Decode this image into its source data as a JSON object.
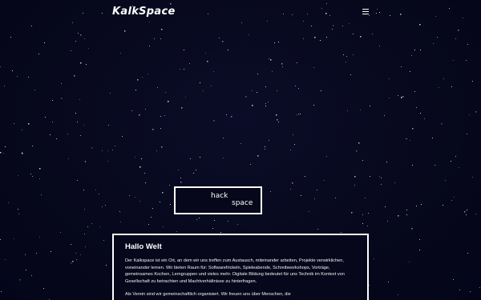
{
  "header": {
    "logo": "KalkSpace",
    "menu_icon": "hamburger-menu-icon"
  },
  "hack_logo": {
    "line1": "hack",
    "line2": "space"
  },
  "card": {
    "title": "Hallo Welt",
    "paragraph1": "Der Kalkspace ist ein Ort, an dem wir uns treffen zum Austausch, miteinander arbeiten, Projekte verwirklichen, voneinander lernen. Wir bieten Raum für: Softwarefrickeln, Spieleabende, Schreibworkshops, Vorträge, gemeinsames Kochen, Lerngruppen und vieles mehr. Digitale Bildung bedeutet für uns Technik im Kontext von Gesellschaft zu betrachten und Machtverhältnisse zu hinterfragen.",
    "paragraph2": "Als Verein sind wir gemeinschaftlich organisiert. Wir freuen uns über Menschen, die"
  },
  "colors": {
    "background": "#06071a",
    "foreground": "#ffffff"
  }
}
